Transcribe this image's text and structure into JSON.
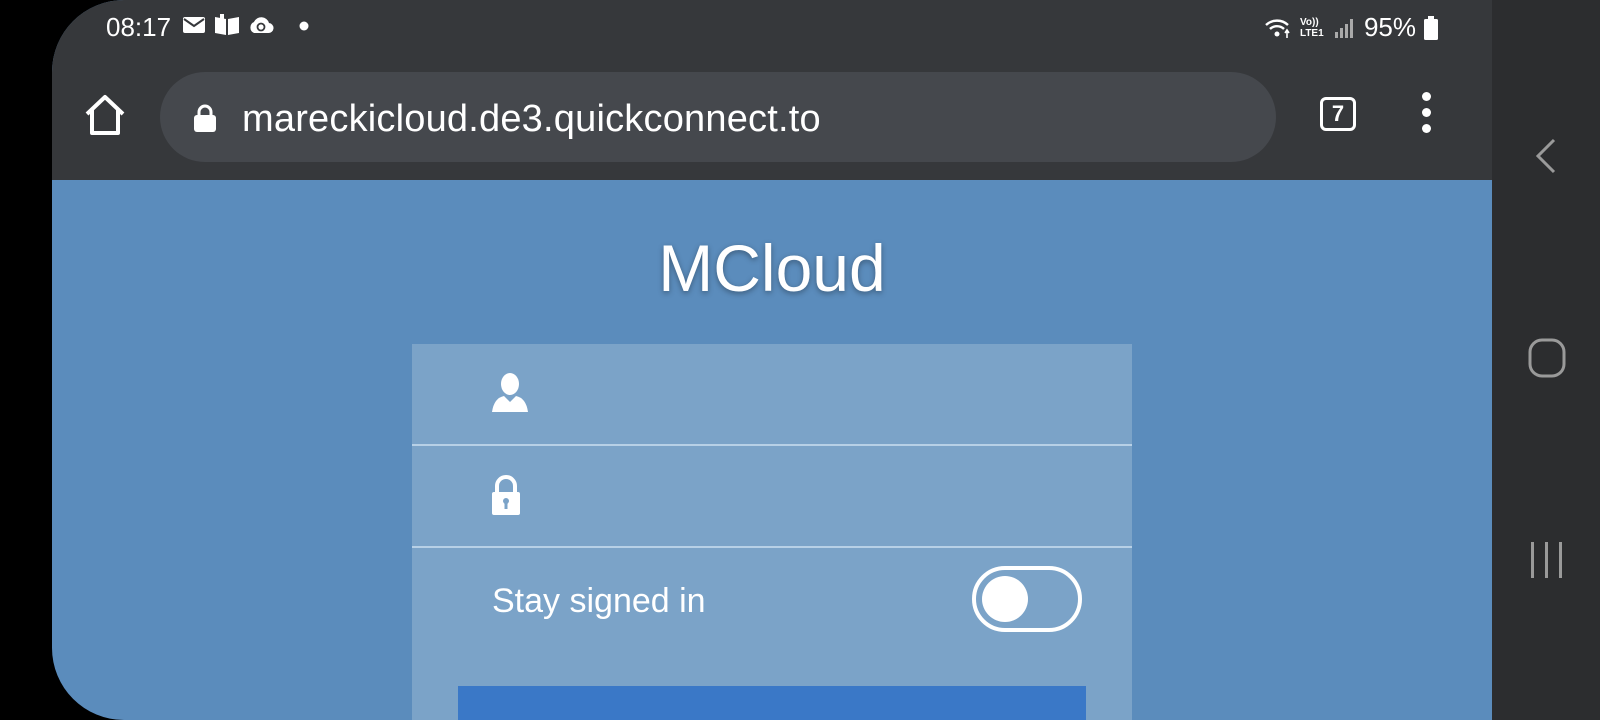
{
  "status_bar": {
    "time": "08:17",
    "notification_icons": [
      "mail-icon",
      "book-icon",
      "cloud-sync-icon",
      "dot-icon"
    ],
    "network_label": "Vo)) LTE1",
    "battery_percent": "95%"
  },
  "browser": {
    "url": "mareckicloud.de3.quickconnect.to",
    "tab_count": "7"
  },
  "page": {
    "title": "MCloud",
    "username_placeholder": "",
    "password_placeholder": "",
    "stay_signed_in_label": "Stay signed in",
    "stay_signed_in_checked": false
  },
  "colors": {
    "page_background": "#5b8cbc",
    "card_background": "#7ba3c8",
    "button": "#3a78c7",
    "browser_chrome": "#36383b"
  }
}
